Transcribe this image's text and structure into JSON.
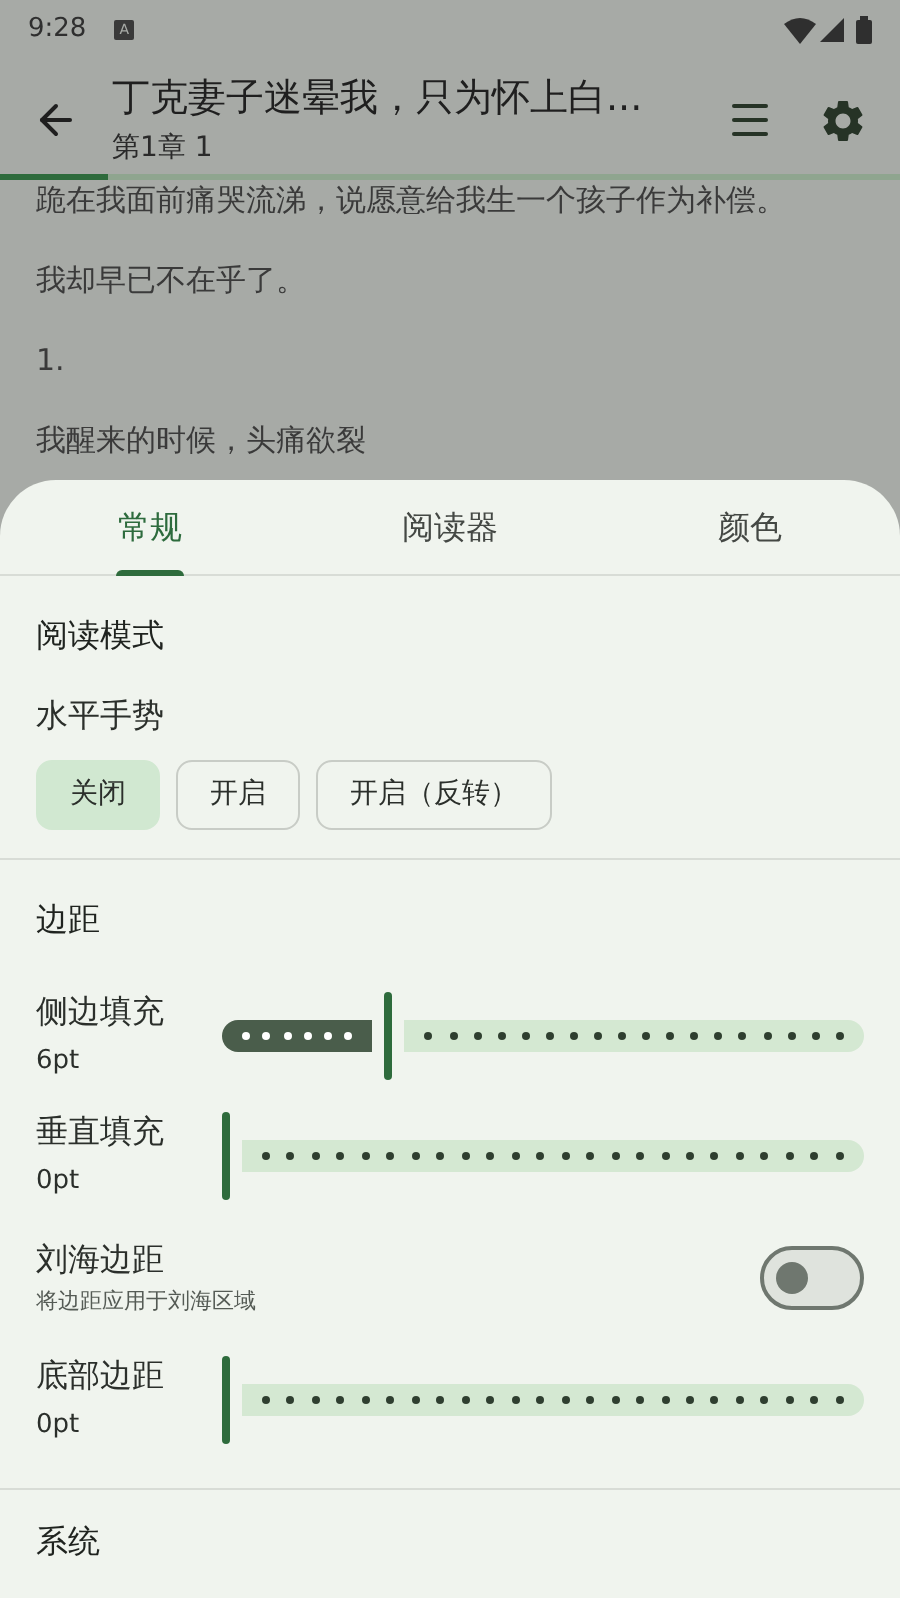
{
  "status_bar": {
    "time": "9:28",
    "badge": "A"
  },
  "app_bar": {
    "title": "丁克妻子迷晕我，只为怀上白...",
    "subtitle": "第1章 1",
    "progress": {
      "level": 0.12
    }
  },
  "reader_lines": [
    "跪在我面前痛哭流涕，说愿意给我生一个孩子作为补偿。",
    "我却早已不在乎了。",
    "1.",
    "我醒来的时候，头痛欲裂"
  ],
  "tabs": [
    {
      "label": "常规",
      "selected": true
    },
    {
      "label": "阅读器",
      "selected": false
    },
    {
      "label": "颜色",
      "selected": false
    }
  ],
  "sections": [
    {
      "heading": "阅读模式",
      "items": [
        {
          "kind": "choices",
          "label": "水平手势",
          "options": [
            {
              "label": "关闭",
              "selected": true
            },
            {
              "label": "开启",
              "selected": false
            },
            {
              "label": "开启（反转）",
              "selected": false
            }
          ]
        }
      ]
    },
    {
      "heading": "边距",
      "items": [
        {
          "kind": "slider",
          "label": "侧边填充",
          "value": "6pt",
          "level": 0.26
        },
        {
          "kind": "slider",
          "label": "垂直填充",
          "value": "0pt",
          "level": 0
        },
        {
          "kind": "switch",
          "label": "刘海边距",
          "description": "将边距应用于刘海区域",
          "on": false
        },
        {
          "kind": "slider",
          "label": "底部边距",
          "value": "0pt",
          "level": 0
        }
      ]
    },
    {
      "heading": "系统"
    }
  ]
}
